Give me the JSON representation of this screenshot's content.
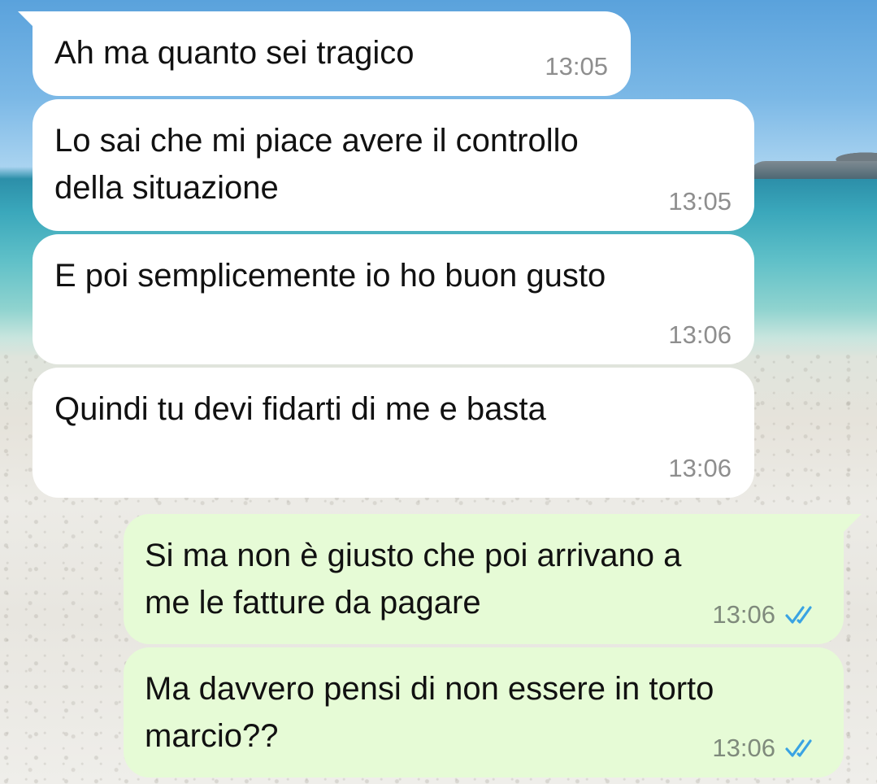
{
  "messages": [
    {
      "direction": "incoming",
      "text": "Ah ma quanto sei tragico",
      "time": "13:05"
    },
    {
      "direction": "incoming",
      "text": "Lo sai che mi piace avere il controllo\ndella situazione",
      "time": "13:05"
    },
    {
      "direction": "incoming",
      "text": "E poi semplicemente io ho buon gusto",
      "time": "13:06"
    },
    {
      "direction": "incoming",
      "text": "Quindi tu devi fidarti di me e basta",
      "time": "13:06"
    },
    {
      "direction": "outgoing",
      "text": "Si ma non è giusto che poi arrivano a\nme le fatture da pagare",
      "time": "13:06",
      "status_icon": "double-check-read-icon"
    },
    {
      "direction": "outgoing",
      "text": "Ma davvero pensi di non essere in torto\nmarcio??",
      "time": "13:06",
      "status_icon": "double-check-read-icon"
    }
  ],
  "colors": {
    "incoming_bubble": "#ffffff",
    "outgoing_bubble": "#e6fbd6",
    "read_tick": "#3aa3e3",
    "timestamp": "#8e8e8e"
  }
}
